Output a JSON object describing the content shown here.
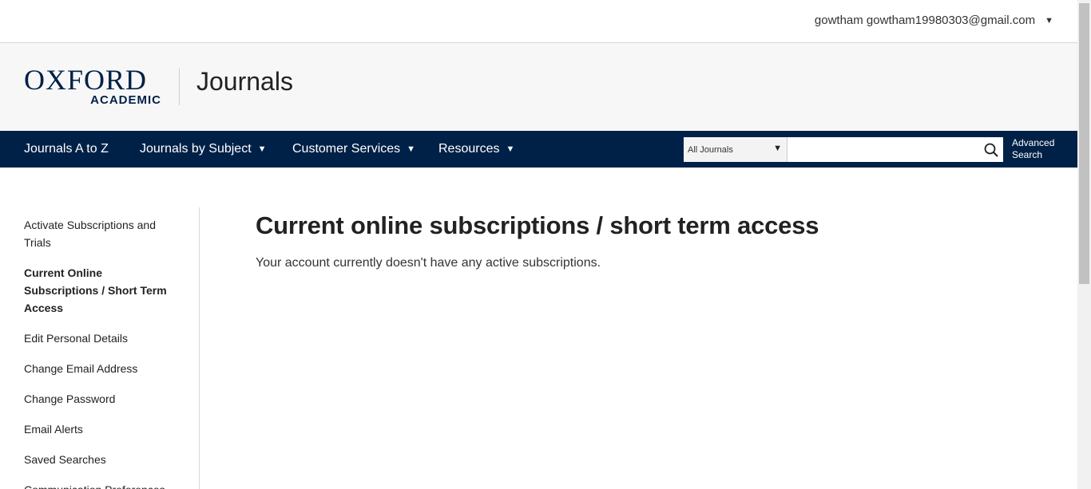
{
  "user": {
    "name": "gowtham gowtham19980303@gmail.com",
    "menu_icon": "caret-down-icon"
  },
  "brand": {
    "logo_main": "OXFORD",
    "logo_sub": "ACADEMIC",
    "site_name": "Journals"
  },
  "nav": {
    "items": [
      {
        "label": "Journals A to Z"
      },
      {
        "label": "Journals by Subject"
      },
      {
        "label": "Customer Services"
      },
      {
        "label": "Resources"
      }
    ],
    "search": {
      "scope": "All Journals",
      "query": "",
      "icon": "search-icon",
      "advanced_line1": "Advanced",
      "advanced_line2": "Search"
    },
    "color": "#002147"
  },
  "sidebar": {
    "items": [
      {
        "label": "Activate Subscriptions and Trials"
      },
      {
        "label": "Current Online Subscriptions / Short Term Access"
      },
      {
        "label": "Edit Personal Details"
      },
      {
        "label": "Change Email Address"
      },
      {
        "label": "Change Password"
      },
      {
        "label": "Email Alerts"
      },
      {
        "label": "Saved Searches"
      },
      {
        "label": "Communication Preferences"
      }
    ],
    "active_index": 1
  },
  "main": {
    "title": "Current online subscriptions / short term access",
    "message": "Your account currently doesn't have any active subscriptions."
  }
}
